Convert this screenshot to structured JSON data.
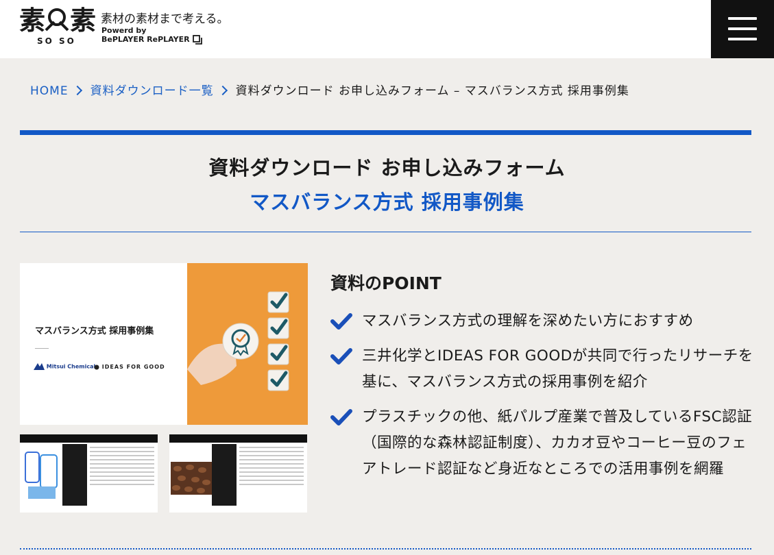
{
  "header": {
    "logo_text": "素",
    "logo_sub": "SO SO",
    "tagline": "素材の素材まで考える。",
    "powered_line1": "Powerd by",
    "powered_line2": "BePLAYER RePLAYER",
    "menu_icon": "hamburger-icon"
  },
  "breadcrumb": {
    "home": "HOME",
    "list": "資料ダウンロード一覧",
    "current": "資料ダウンロード お申し込みフォーム – マスバランス方式 採用事例集"
  },
  "page": {
    "title": "資料ダウンロード お申し込みフォーム",
    "subtitle": "マスバランス方式 採用事例集"
  },
  "preview": {
    "doc_title": "マスバランス方式 採用事例集",
    "mc_logo": "Mitsui Chemicals",
    "ifg_logo": "IDEAS FOR GOOD"
  },
  "point": {
    "heading": "資料のPOINT",
    "items": [
      "マスバランス方式の理解を深めたい方におすすめ",
      "三井化学とIDEAS FOR GOODが共同で行ったリサーチを基に、マスバランス方式の採用事例を紹介",
      "プラスチックの他、紙パルプ産業で普及しているFSC認証（国際的な森林認証制度）、カカオ豆やコーヒー豆のフェアトレード認証など身近なところでの活用事例を網羅"
    ]
  },
  "colors": {
    "accent": "#1258c6",
    "background": "#f0eeeb",
    "orange": "#ee9a3a"
  }
}
